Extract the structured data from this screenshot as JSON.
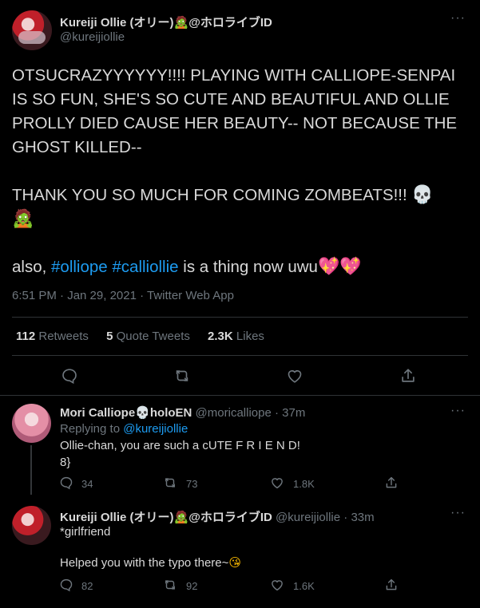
{
  "main_tweet": {
    "display_name": "Kureiji Ollie (オリー)",
    "name_suffix": "@ホロライブID",
    "name_emoji": "🧟",
    "handle": "@kureijiollie",
    "para1": "OTSUCRAZYYYYYY!!!! PLAYING WITH CALLIOPE-SENPAI IS SO FUN, SHE'S SO CUTE AND BEAUTIFUL AND OLLIE PROLLY DIED CAUSE HER BEAUTY-- NOT BECAUSE THE GHOST KILLED--",
    "para2": "THANK YOU SO MUCH FOR COMING ZOMBEATS!!!",
    "para2_emoji1": "💀",
    "para2_emoji2": "🧟",
    "para3_prefix": "also,",
    "hashtag1": "#olliope",
    "hashtag2": "#calliollie",
    "para3_suffix": "is a thing now uwu",
    "para3_emoji": "💖💖",
    "timestamp": "6:51 PM · Jan 29, 2021 · Twitter Web App",
    "retweets_count": "112",
    "retweets_label": "Retweets",
    "quotes_count": "5",
    "quotes_label": "Quote Tweets",
    "likes_count": "2.3K",
    "likes_label": "Likes"
  },
  "replies": [
    {
      "display_name": "Mori Calliope",
      "name_emoji": "💀",
      "name_suffix": "holoEN",
      "handle": "@moricalliope",
      "time": "· 37m",
      "replying_prefix": "Replying to",
      "replying_handle": "@kureijiollie",
      "line1": "Ollie-chan, you are such a cUTE F R I E N D!",
      "line2": "8}",
      "replies": "34",
      "retweets": "73",
      "likes": "1.8K"
    },
    {
      "display_name": "Kureiji Ollie (オリー)",
      "name_emoji": "🧟",
      "name_suffix": "@ホロライブID",
      "handle": "@kureijiollie",
      "time": "· 33m",
      "line1": "*girlfriend",
      "line2": "Helped you with the typo there~",
      "line2_emoji": "😘",
      "replies": "82",
      "retweets": "92",
      "likes": "1.6K"
    }
  ],
  "more_glyph": "···",
  "colors": {
    "background": "#000000",
    "text": "#d9d9d9",
    "muted": "#6e767d",
    "link": "#1d9bf0",
    "divider": "#2f3336"
  }
}
